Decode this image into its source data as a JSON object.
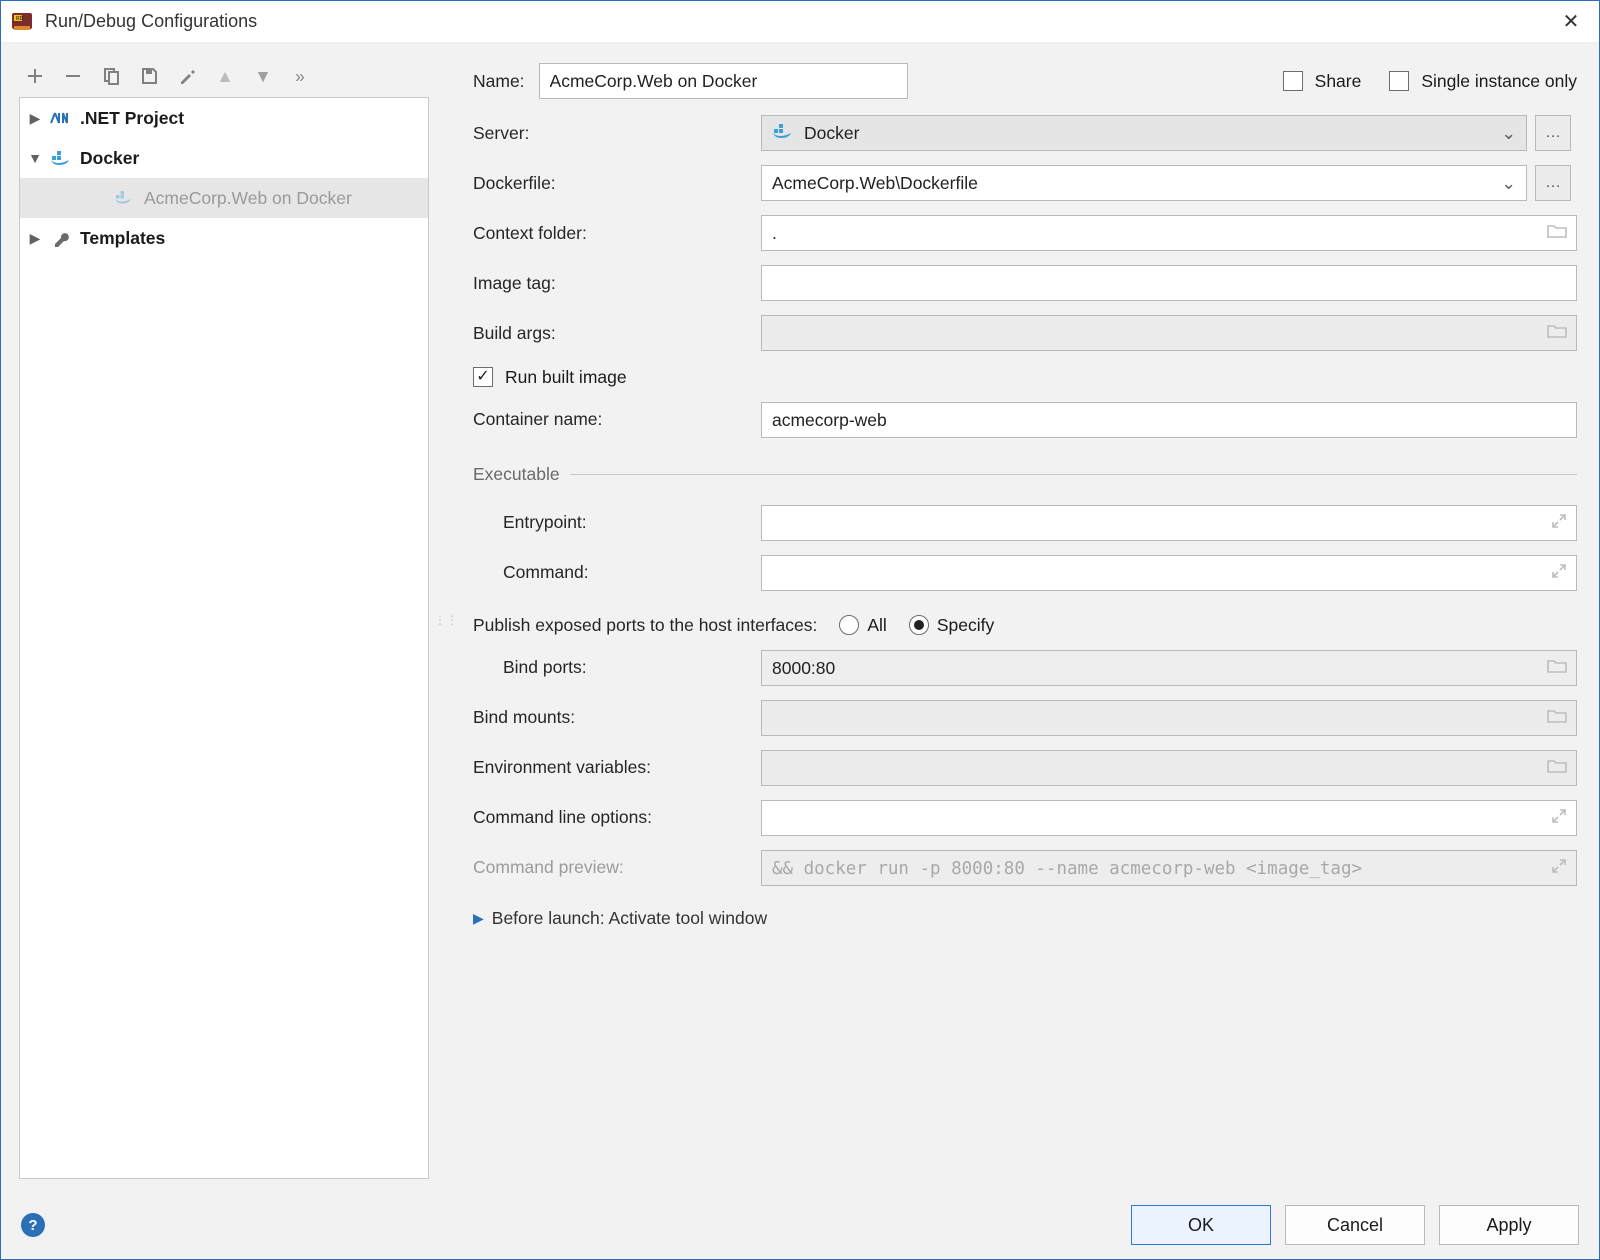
{
  "window": {
    "title": "Run/Debug Configurations"
  },
  "toolbar": {
    "add": "add",
    "remove": "remove",
    "copy": "copy",
    "save": "save",
    "wrench": "wrench",
    "up": "up",
    "down": "down",
    "more": "more"
  },
  "tree": {
    "net_project": ".NET Project",
    "docker": "Docker",
    "docker_child": "AcmeCorp.Web on Docker",
    "templates": "Templates"
  },
  "labels": {
    "name": "Name:",
    "share": "Share",
    "single_instance": "Single instance only",
    "server": "Server:",
    "server_value": "Docker",
    "dockerfile": "Dockerfile:",
    "context_folder": "Context folder:",
    "image_tag": "Image tag:",
    "build_args": "Build args:",
    "run_built_image": "Run built image",
    "container_name": "Container name:",
    "executable": "Executable",
    "entrypoint": "Entrypoint:",
    "command": "Command:",
    "publish_ports": "Publish exposed ports to the host interfaces:",
    "all": "All",
    "specify": "Specify",
    "bind_ports": "Bind ports:",
    "bind_mounts": "Bind mounts:",
    "env_vars": "Environment variables:",
    "cmd_line_opts": "Command line options:",
    "cmd_preview": "Command preview:",
    "before_launch": "Before launch: Activate tool window"
  },
  "values": {
    "name": "AcmeCorp.Web on Docker",
    "dockerfile": "AcmeCorp.Web\\Dockerfile",
    "context_folder": ".",
    "image_tag": "",
    "build_args": "",
    "run_built_image_checked": true,
    "container_name": "acmecorp-web",
    "entrypoint": "",
    "command": "",
    "ports_selected": "specify",
    "bind_ports": "8000:80",
    "bind_mounts": "",
    "env_vars": "",
    "cmd_line_opts": "",
    "cmd_preview": "&& docker run -p 8000:80 --name acmecorp-web <image_tag>"
  },
  "checks": {
    "share": false,
    "single_instance": false
  },
  "buttons": {
    "ok": "OK",
    "cancel": "Cancel",
    "apply": "Apply"
  }
}
